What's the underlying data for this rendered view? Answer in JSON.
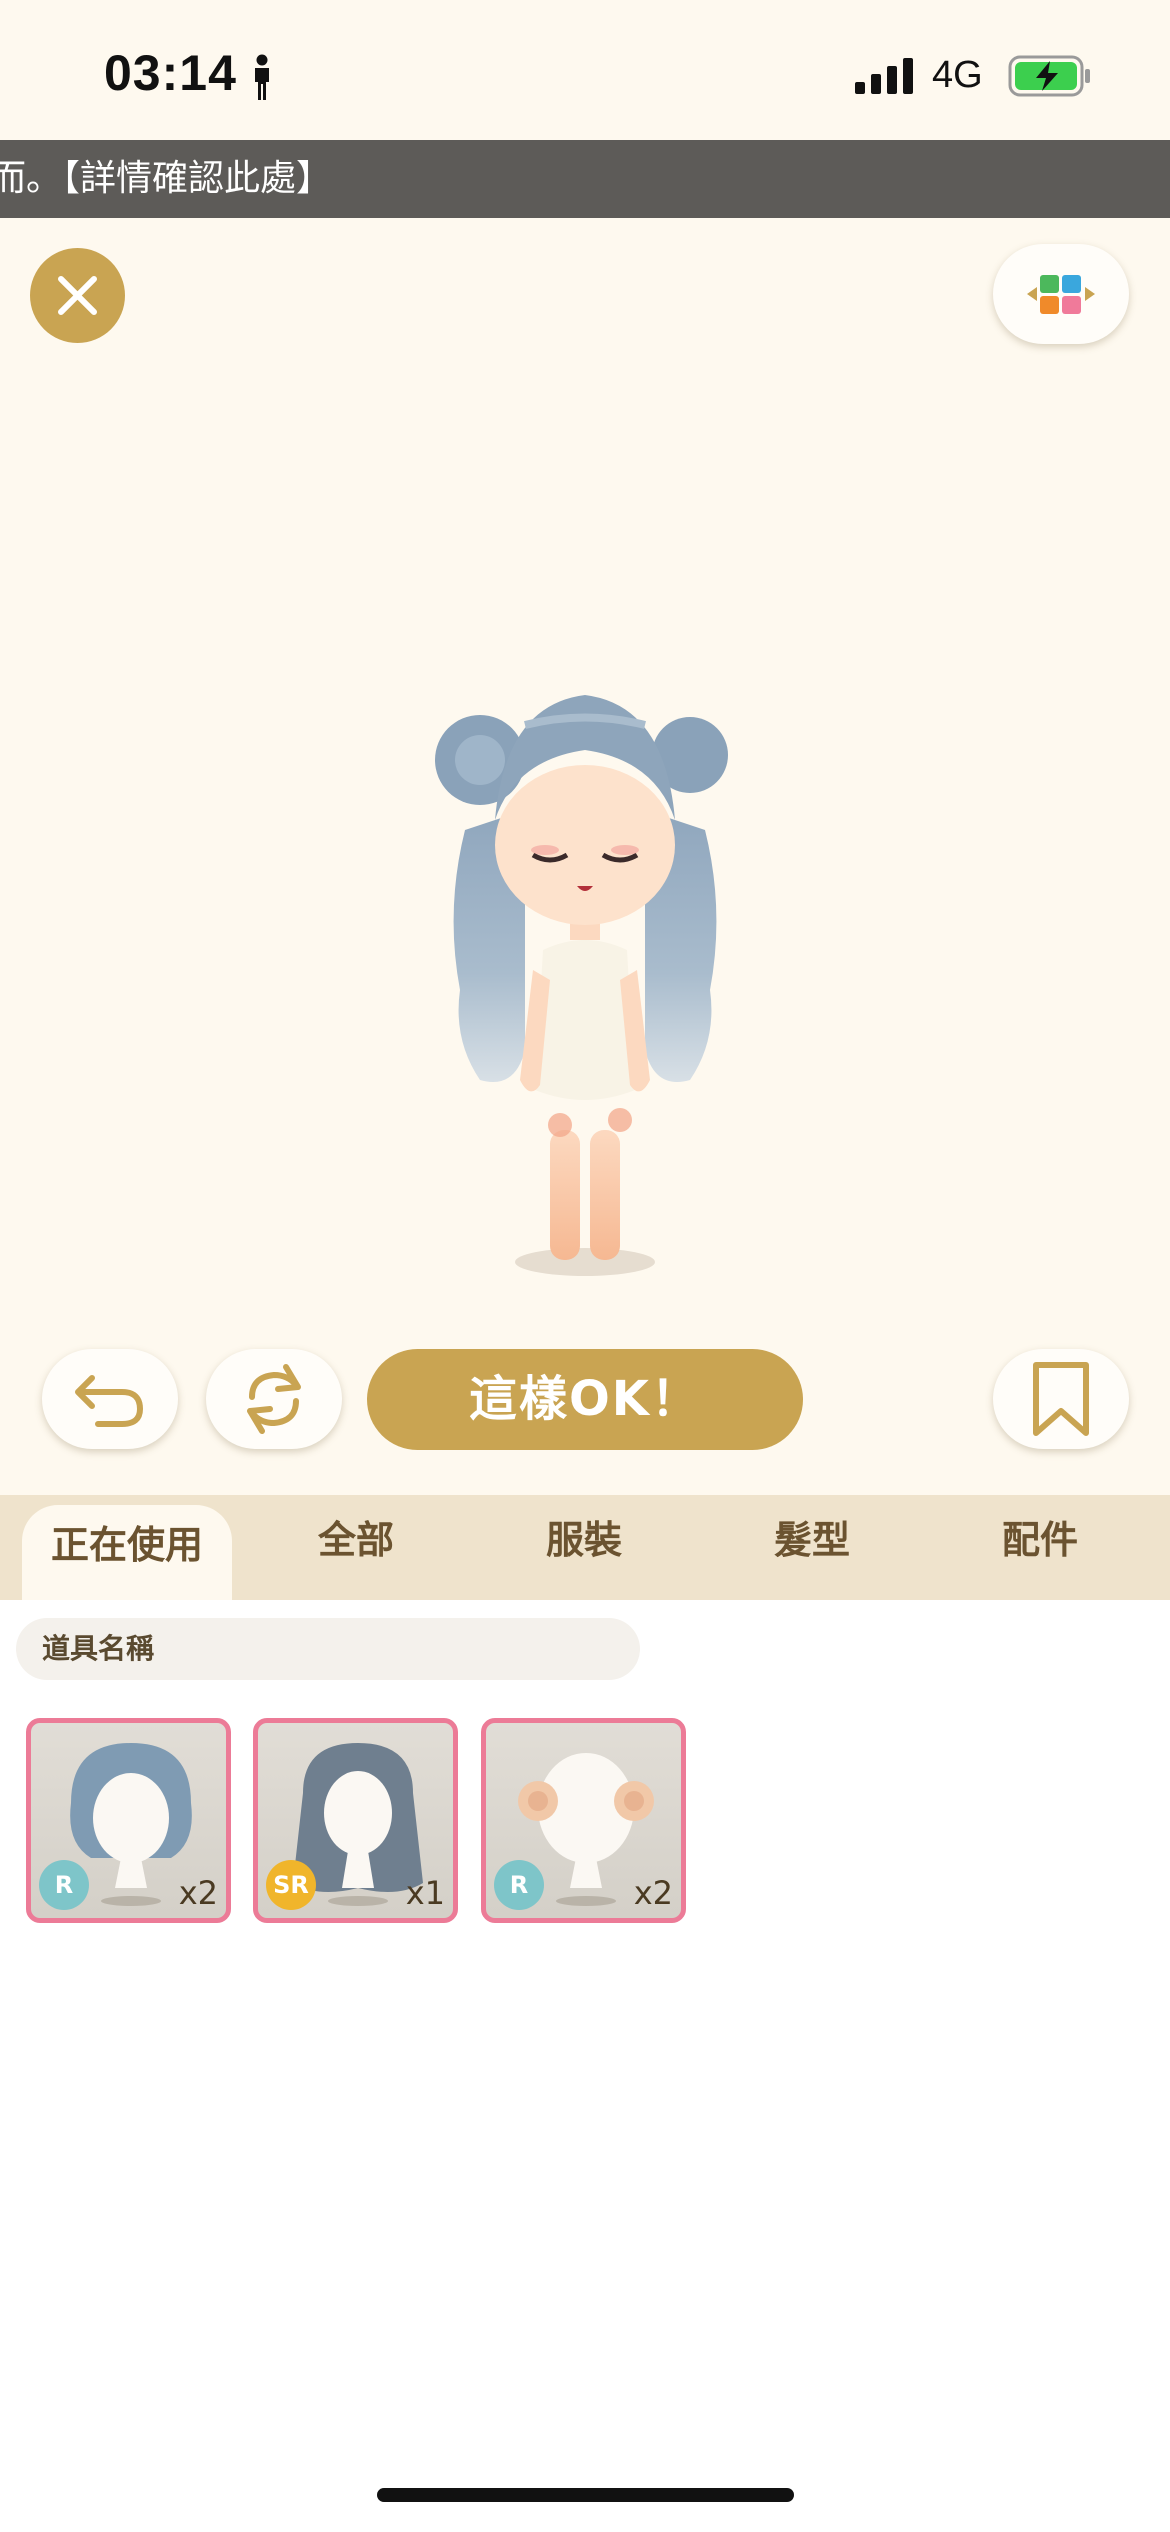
{
  "status_bar": {
    "time": "03:14",
    "network": "4G",
    "icons": [
      "person-icon",
      "signal-bars-icon",
      "battery-charging-icon"
    ]
  },
  "marquee": {
    "text": "而。【詳情確認此處】"
  },
  "header": {
    "close_icon": "close-icon",
    "palette_icon": "color-palette-icon"
  },
  "actions": {
    "undo_icon": "undo-icon",
    "rotate_icon": "rotate-icon",
    "ok_label": "這樣OK！",
    "bookmark_icon": "bookmark-icon"
  },
  "tabs": [
    {
      "label": "正在使用",
      "active": true
    },
    {
      "label": "全部",
      "active": false
    },
    {
      "label": "服裝",
      "active": false
    },
    {
      "label": "髮型",
      "active": false
    },
    {
      "label": "配件",
      "active": false
    }
  ],
  "search": {
    "placeholder": "道具名稱"
  },
  "items": [
    {
      "rarity": "R",
      "quantity": "x2",
      "rarity_color": "#7ec5c9"
    },
    {
      "rarity": "SR",
      "quantity": "x1",
      "rarity_color": "#f0b52b"
    },
    {
      "rarity": "R",
      "quantity": "x2",
      "rarity_color": "#7ec5c9"
    }
  ],
  "colors": {
    "accent_gold": "#c9a452",
    "background_cream": "#fef9ef",
    "tab_bar": "#efe3cc",
    "item_border_pink": "#ec7b97"
  }
}
